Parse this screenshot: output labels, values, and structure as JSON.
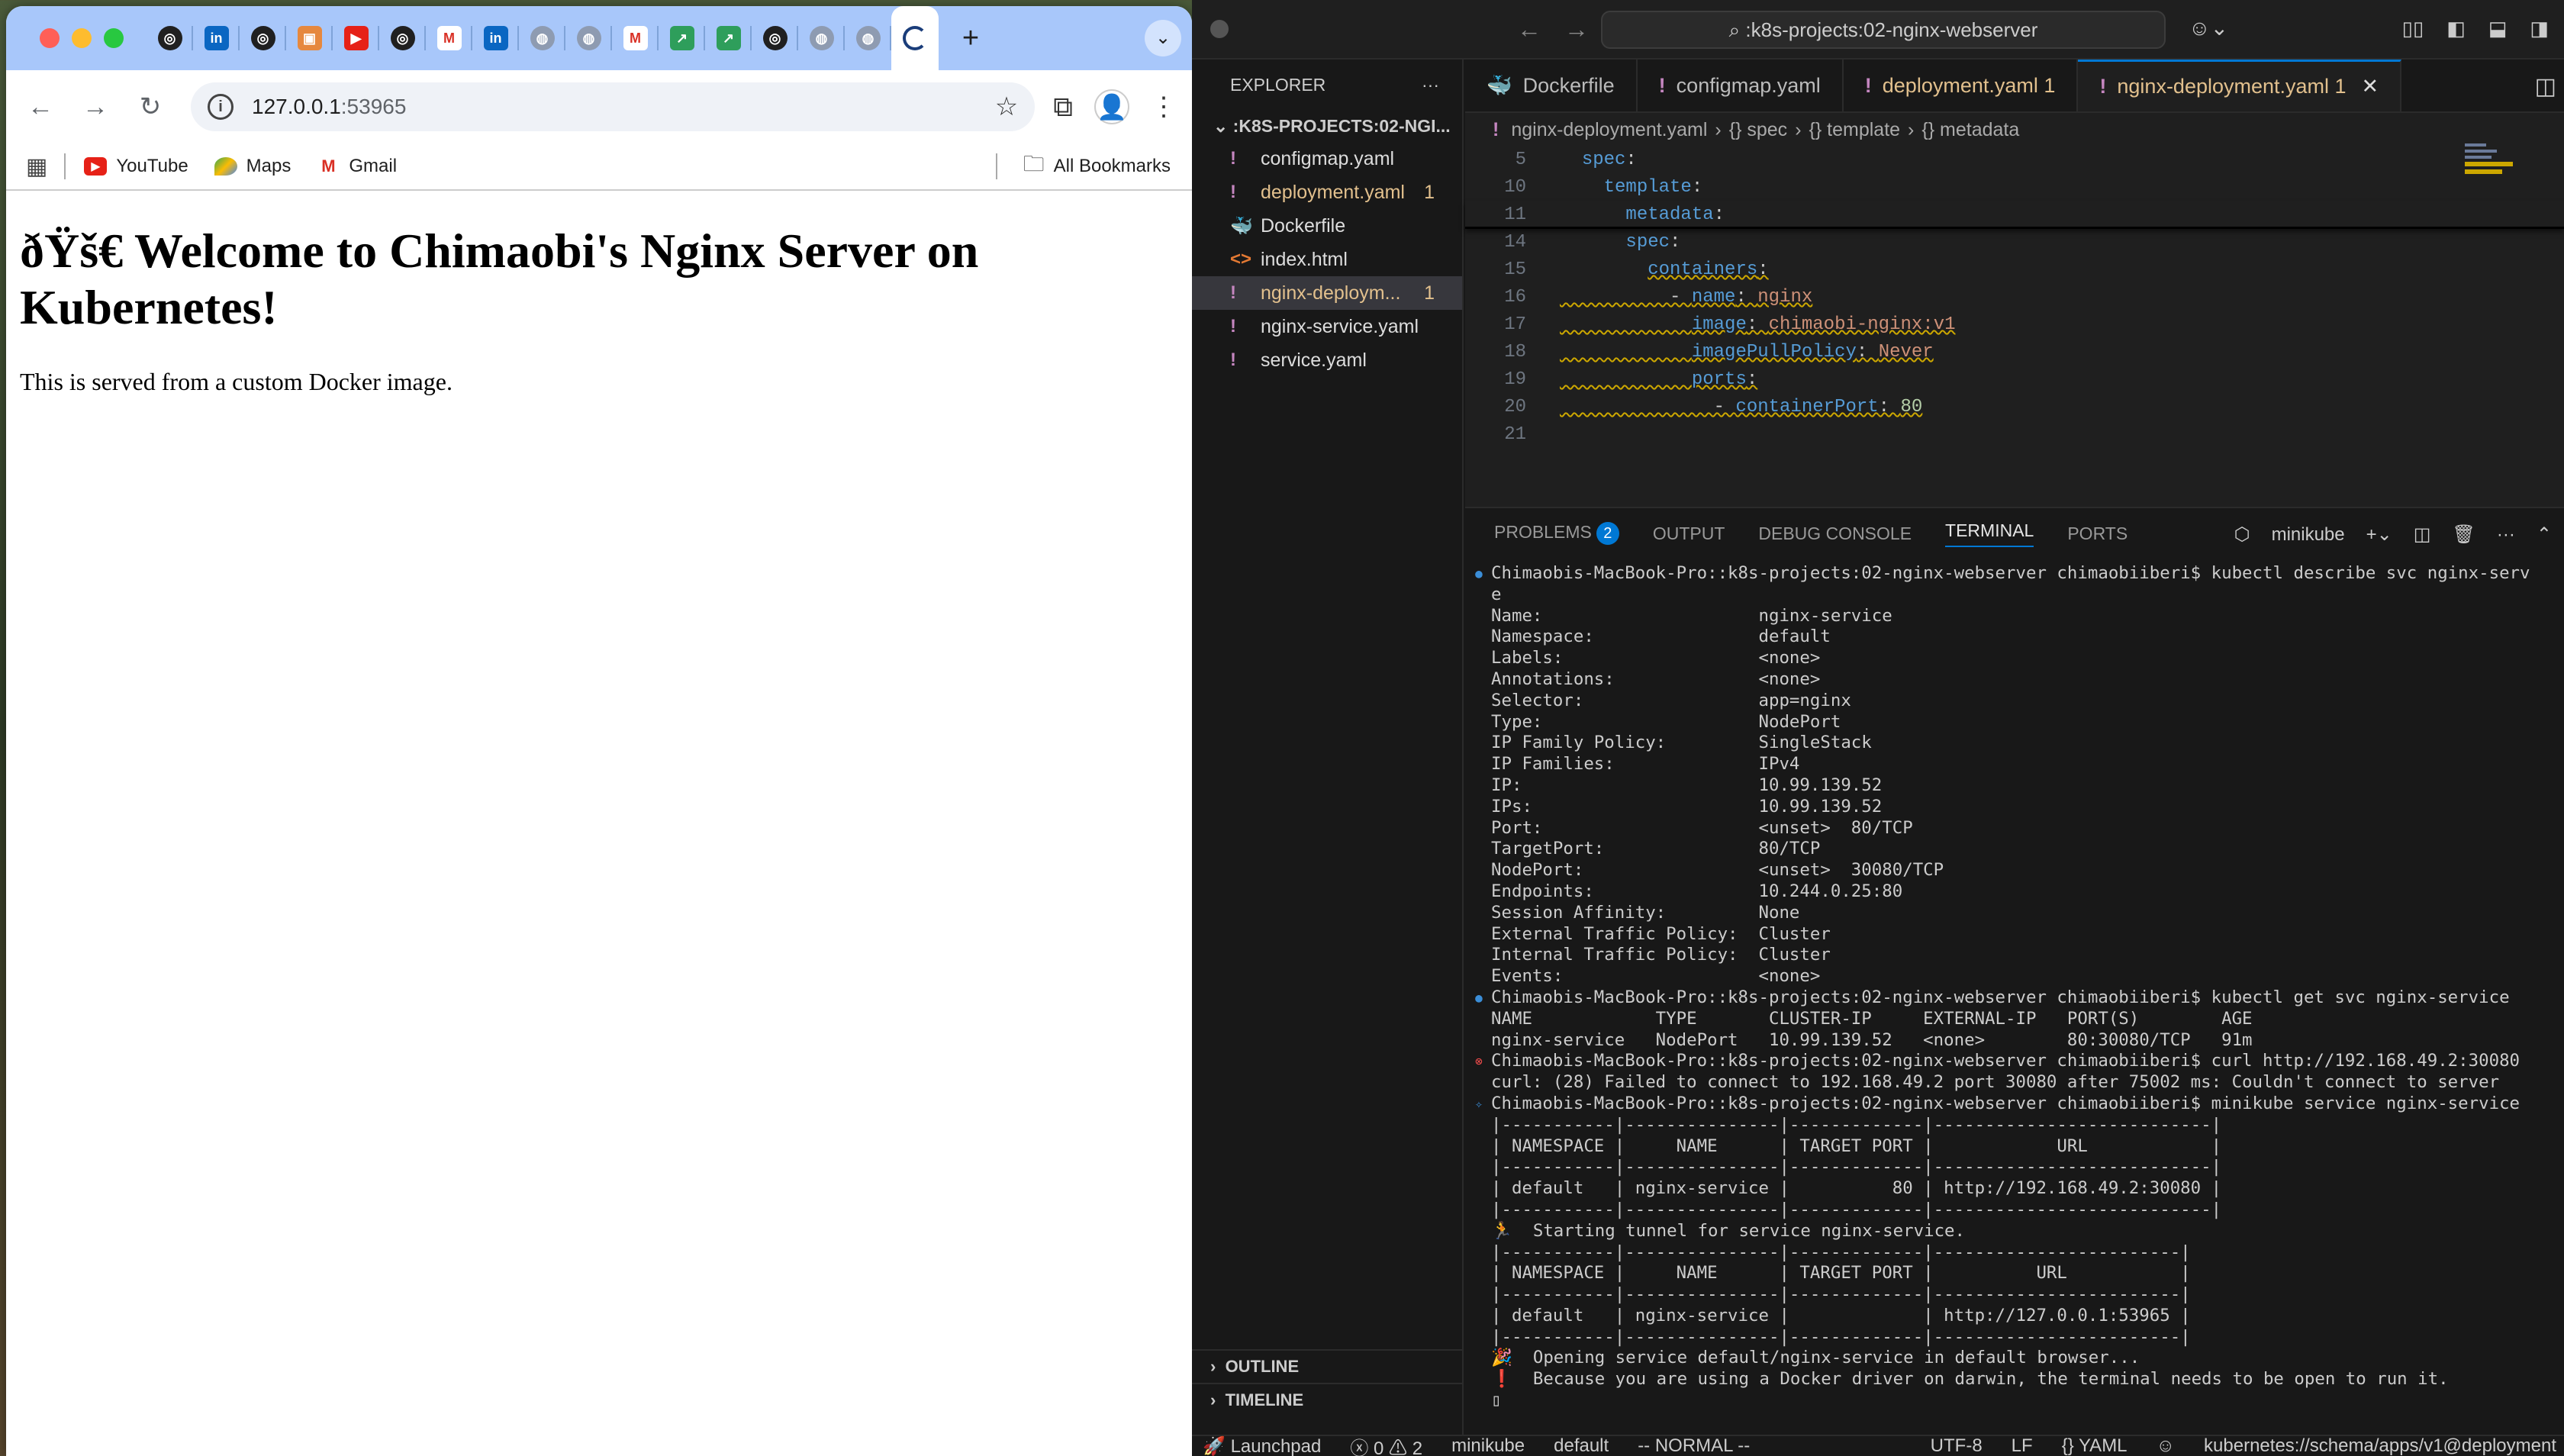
{
  "browser": {
    "tabs": [
      {
        "icon": "openai-icon",
        "cls": "fav-o",
        "glyph": "◎"
      },
      {
        "icon": "linkedin-icon",
        "cls": "fav-li",
        "glyph": "in"
      },
      {
        "icon": "openai-icon",
        "cls": "fav-o",
        "glyph": "◎"
      },
      {
        "icon": "package-icon",
        "cls": "fav-box",
        "glyph": "▣"
      },
      {
        "icon": "youtube-icon",
        "cls": "fav-yt",
        "glyph": "▶"
      },
      {
        "icon": "openai-icon",
        "cls": "fav-o",
        "glyph": "◎"
      },
      {
        "icon": "gmail-icon",
        "cls": "fav-gm",
        "glyph": "M"
      },
      {
        "icon": "linkedin-icon",
        "cls": "fav-li",
        "glyph": "in"
      },
      {
        "icon": "globe-icon",
        "cls": "fav-gl",
        "glyph": "◍"
      },
      {
        "icon": "globe-icon",
        "cls": "fav-gl",
        "glyph": "◍"
      },
      {
        "icon": "gmail-icon",
        "cls": "fav-gm",
        "glyph": "M"
      },
      {
        "icon": "chart-icon",
        "cls": "fav-grn",
        "glyph": "↗"
      },
      {
        "icon": "chart-icon",
        "cls": "fav-grn",
        "glyph": "↗"
      },
      {
        "icon": "openai-icon",
        "cls": "fav-o",
        "glyph": "◎"
      },
      {
        "icon": "globe-icon",
        "cls": "fav-gl",
        "glyph": "◍"
      },
      {
        "icon": "globe-icon",
        "cls": "fav-gl",
        "glyph": "◍"
      },
      {
        "icon": "loading-icon",
        "cls": "fav-load",
        "glyph": ""
      }
    ],
    "new_tab": "+",
    "url_host": "127.0.0.1",
    "url_port": ":53965",
    "bookmarks": [
      "YouTube",
      "Maps",
      "Gmail"
    ],
    "all_bookmarks": "All Bookmarks",
    "page_heading": "ðŸš€ Welcome to Chimaobi's Nginx Server on Kubernetes!",
    "page_text": "This is served from a custom Docker image."
  },
  "vscode": {
    "search": ":k8s-projects:02-nginx-webserver",
    "explorer_title": "EXPLORER",
    "project": ":K8S-PROJECTS:02-NGI...",
    "files": [
      {
        "name": "configmap.yaml",
        "icon": "!",
        "type": "yaml",
        "mod": false,
        "count": ""
      },
      {
        "name": "deployment.yaml",
        "icon": "!",
        "type": "yaml",
        "mod": true,
        "count": "1"
      },
      {
        "name": "Dockerfile",
        "icon": "🐳",
        "type": "docker",
        "mod": false,
        "count": ""
      },
      {
        "name": "index.html",
        "icon": "<>",
        "type": "html",
        "mod": false,
        "count": ""
      },
      {
        "name": "nginx-deploym...",
        "icon": "!",
        "type": "yaml",
        "mod": true,
        "count": "1",
        "selected": true
      },
      {
        "name": "nginx-service.yaml",
        "icon": "!",
        "type": "yaml",
        "mod": false,
        "count": ""
      },
      {
        "name": "service.yaml",
        "icon": "!",
        "type": "yaml",
        "mod": false,
        "count": ""
      }
    ],
    "outline": "OUTLINE",
    "timeline": "TIMELINE",
    "tabs": [
      {
        "name": "Dockerfile",
        "icon": "🐳",
        "mod": false
      },
      {
        "name": "configmap.yaml",
        "icon": "!",
        "mod": false
      },
      {
        "name": "deployment.yaml 1",
        "icon": "!",
        "mod": true
      },
      {
        "name": "nginx-deployment.yaml 1",
        "icon": "!",
        "mod": true,
        "active": true
      }
    ],
    "breadcrumb": [
      "nginx-deployment.yaml",
      "{} spec",
      "{} template",
      "{} metadata"
    ],
    "code": [
      {
        "n": "5",
        "t": "  <k>spec</k>:",
        "sticky": true
      },
      {
        "n": "10",
        "t": "    <k>template</k>:",
        "sticky": true
      },
      {
        "n": "11",
        "t": "      <k>metadata</k>:",
        "sticky": true,
        "last": true
      },
      {
        "n": "14",
        "t": "      <k>spec</k>:"
      },
      {
        "n": "15",
        "t": "        <q><k>containers</k>:</q>"
      },
      {
        "n": "16",
        "t": "<q>          - <k>name</k>: <s>nginx</s></q>"
      },
      {
        "n": "17",
        "t": "<q>            <k>image</k>: <s>chimaobi-nginx:v1</s></q>"
      },
      {
        "n": "18",
        "t": "<q>            <k>imagePullPolicy</k>: <s>Never</s></q>"
      },
      {
        "n": "19",
        "t": "<q>            <k>ports</k>:</q>"
      },
      {
        "n": "20",
        "t": "<q>              - <k>containerPort</k>: <n>80</n></q>"
      },
      {
        "n": "21",
        "t": ""
      }
    ],
    "panel_tabs": [
      "PROBLEMS",
      "OUTPUT",
      "DEBUG CONSOLE",
      "TERMINAL",
      "PORTS"
    ],
    "problems_count": "2",
    "terminal_name": "minikube",
    "terminal": [
      {
        "m": "blue",
        "t": "Chimaobis-MacBook-Pro::k8s-projects:02-nginx-webserver chimaobiiberi$ kubectl describe svc nginx-serv"
      },
      {
        "m": "",
        "t": "e"
      },
      {
        "m": "",
        "t": "Name:                     nginx-service"
      },
      {
        "m": "",
        "t": "Namespace:                default"
      },
      {
        "m": "",
        "t": "Labels:                   <none>"
      },
      {
        "m": "",
        "t": "Annotations:              <none>"
      },
      {
        "m": "",
        "t": "Selector:                 app=nginx"
      },
      {
        "m": "",
        "t": "Type:                     NodePort"
      },
      {
        "m": "",
        "t": "IP Family Policy:         SingleStack"
      },
      {
        "m": "",
        "t": "IP Families:              IPv4"
      },
      {
        "m": "",
        "t": "IP:                       10.99.139.52"
      },
      {
        "m": "",
        "t": "IPs:                      10.99.139.52"
      },
      {
        "m": "",
        "t": "Port:                     <unset>  80/TCP"
      },
      {
        "m": "",
        "t": "TargetPort:               80/TCP"
      },
      {
        "m": "",
        "t": "NodePort:                 <unset>  30080/TCP"
      },
      {
        "m": "",
        "t": "Endpoints:                10.244.0.25:80"
      },
      {
        "m": "",
        "t": "Session Affinity:         None"
      },
      {
        "m": "",
        "t": "External Traffic Policy:  Cluster"
      },
      {
        "m": "",
        "t": "Internal Traffic Policy:  Cluster"
      },
      {
        "m": "",
        "t": "Events:                   <none>"
      },
      {
        "m": "blue",
        "t": "Chimaobis-MacBook-Pro::k8s-projects:02-nginx-webserver chimaobiiberi$ kubectl get svc nginx-service"
      },
      {
        "m": "",
        "t": "NAME            TYPE       CLUSTER-IP     EXTERNAL-IP   PORT(S)        AGE"
      },
      {
        "m": "",
        "t": "nginx-service   NodePort   10.99.139.52   <none>        80:30080/TCP   91m"
      },
      {
        "m": "red",
        "t": "Chimaobis-MacBook-Pro::k8s-projects:02-nginx-webserver chimaobiiberi$ curl http://192.168.49.2:30080"
      },
      {
        "m": "",
        "t": "curl: (28) Failed to connect to 192.168.49.2 port 30080 after 75002 ms: Couldn't connect to server"
      },
      {
        "m": "spark",
        "t": "Chimaobis-MacBook-Pro::k8s-projects:02-nginx-webserver chimaobiiberi$ minikube service nginx-service"
      },
      {
        "m": "",
        "t": "|-----------|---------------|-------------|---------------------------|"
      },
      {
        "m": "",
        "t": "| NAMESPACE |     NAME      | TARGET PORT |            URL            |"
      },
      {
        "m": "",
        "t": "|-----------|---------------|-------------|---------------------------|"
      },
      {
        "m": "",
        "t": "| default   | nginx-service |          80 | http://192.168.49.2:30080 |"
      },
      {
        "m": "",
        "t": "|-----------|---------------|-------------|---------------------------|"
      },
      {
        "m": "",
        "t": "🏃  Starting tunnel for service nginx-service."
      },
      {
        "m": "",
        "t": "|-----------|---------------|-------------|------------------------|"
      },
      {
        "m": "",
        "t": "| NAMESPACE |     NAME      | TARGET PORT |          URL           |"
      },
      {
        "m": "",
        "t": "|-----------|---------------|-------------|------------------------|"
      },
      {
        "m": "",
        "t": "| default   | nginx-service |             | http://127.0.0.1:53965 |"
      },
      {
        "m": "",
        "t": "|-----------|---------------|-------------|------------------------|"
      },
      {
        "m": "",
        "t": "🎉  Opening service default/nginx-service in default browser..."
      },
      {
        "m": "",
        "t": "❗  Because you are using a Docker driver on darwin, the terminal needs to be open to run it."
      },
      {
        "m": "",
        "t": "▯"
      }
    ],
    "status": {
      "launchpad": "Launchpad",
      "errors": "0",
      "warnings": "2",
      "context": "minikube",
      "namespace": "default",
      "mode": "-- NORMAL --",
      "encoding": "UTF-8",
      "eol": "LF",
      "language": "YAML",
      "schema": "kubernetes://schema/apps/v1@deployment"
    }
  }
}
